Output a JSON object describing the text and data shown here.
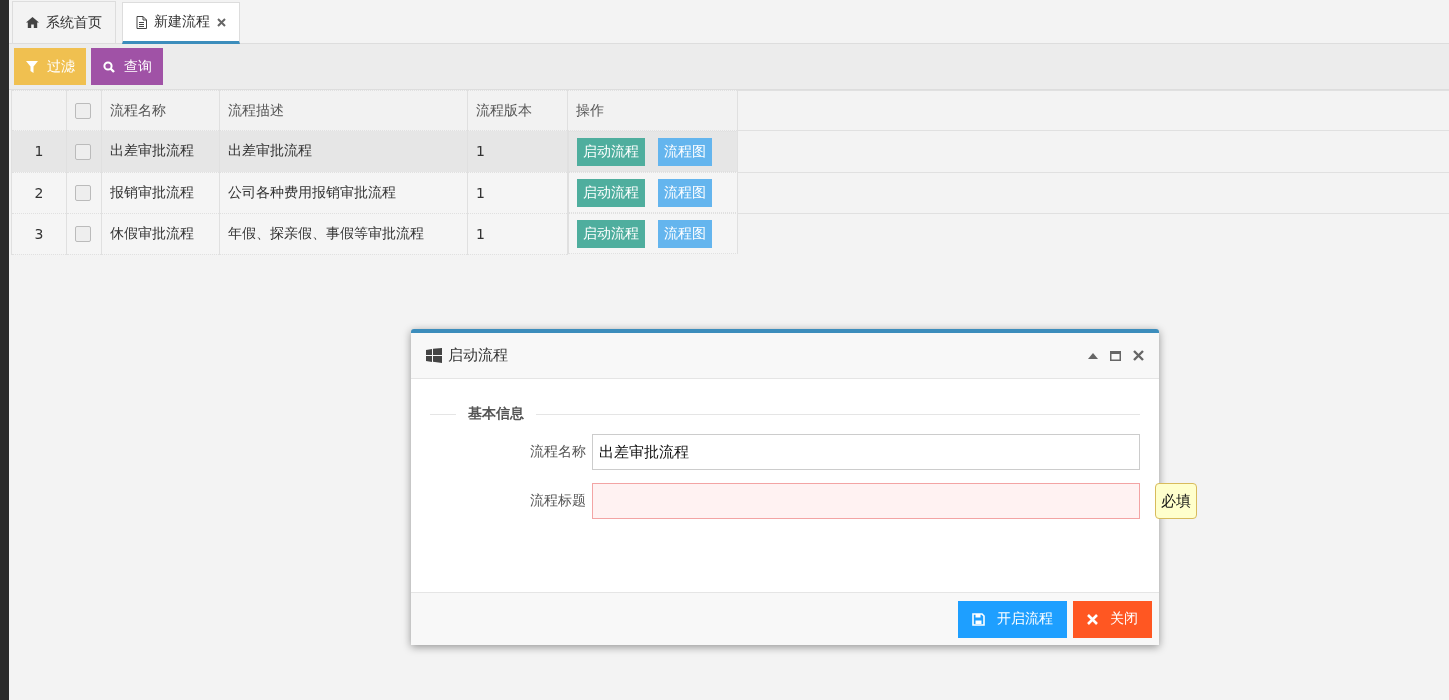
{
  "tabs": [
    {
      "label": "系统首页",
      "kind": "home",
      "selected": false,
      "closable": false
    },
    {
      "label": "新建流程",
      "kind": "document",
      "selected": true,
      "closable": true
    }
  ],
  "toolbar": [
    {
      "label": "过滤",
      "kind": "filter"
    },
    {
      "label": "查询",
      "kind": "search"
    }
  ],
  "table": {
    "select_all_checked": false,
    "columns": [
      "流程名称",
      "流程描述",
      "流程版本",
      "操作"
    ],
    "rows": [
      {
        "index": "1",
        "checked": false,
        "selected": true,
        "name": "出差审批流程",
        "description": "出差审批流程",
        "version": "1",
        "actions": [
          "启动流程",
          "流程图"
        ]
      },
      {
        "index": "2",
        "checked": false,
        "selected": false,
        "name": "报销审批流程",
        "description": "公司各种费用报销审批流程",
        "version": "1",
        "actions": [
          "启动流程",
          "流程图"
        ]
      },
      {
        "index": "3",
        "checked": false,
        "selected": false,
        "name": "休假审批流程",
        "description": "年假、探亲假、事假等审批流程",
        "version": "1",
        "actions": [
          "启动流程",
          "流程图"
        ]
      }
    ]
  },
  "dialog": {
    "title": "启动流程",
    "section": "基本信息",
    "fields": [
      {
        "label": "流程名称",
        "value": "出差审批流程",
        "invalid": false
      },
      {
        "label": "流程标题",
        "invalid": true,
        "tooltip": "必填"
      }
    ],
    "buttons": [
      {
        "label": "开启流程",
        "kind": "save"
      },
      {
        "label": "关闭",
        "kind": "close"
      }
    ]
  }
}
